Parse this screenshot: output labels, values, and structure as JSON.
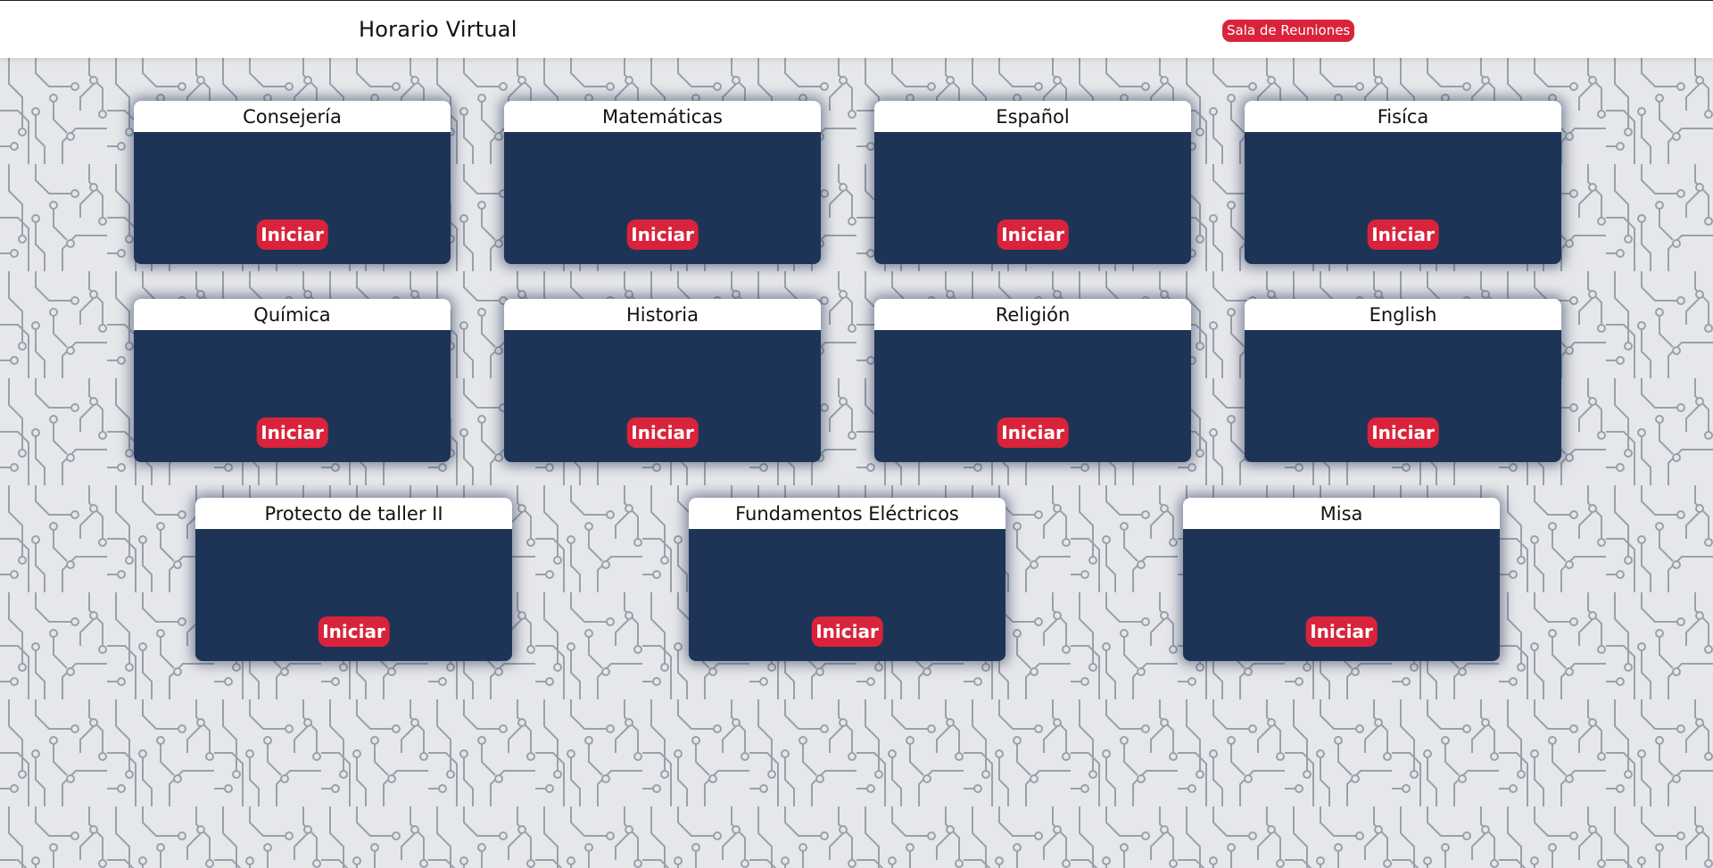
{
  "header": {
    "title": "Horario Virtual",
    "meeting_button": "Sala de Reuniones"
  },
  "cards": [
    {
      "title": "Consejería",
      "button": "Iniciar"
    },
    {
      "title": "Matemáticas",
      "button": "Iniciar"
    },
    {
      "title": "Español",
      "button": "Iniciar"
    },
    {
      "title": "Fisíca",
      "button": "Iniciar"
    },
    {
      "title": "Química",
      "button": "Iniciar"
    },
    {
      "title": "Historia",
      "button": "Iniciar"
    },
    {
      "title": "Religión",
      "button": "Iniciar"
    },
    {
      "title": "English",
      "button": "Iniciar"
    },
    {
      "title": "Protecto de taller II",
      "button": "Iniciar"
    },
    {
      "title": "Fundamentos Eléctricos",
      "button": "Iniciar"
    },
    {
      "title": "Misa",
      "button": "Iniciar"
    }
  ],
  "colors": {
    "accent": "#d9233b",
    "card_body": "#1e3456",
    "background": "#e6e7ea",
    "trace": "#9aa0ab"
  }
}
